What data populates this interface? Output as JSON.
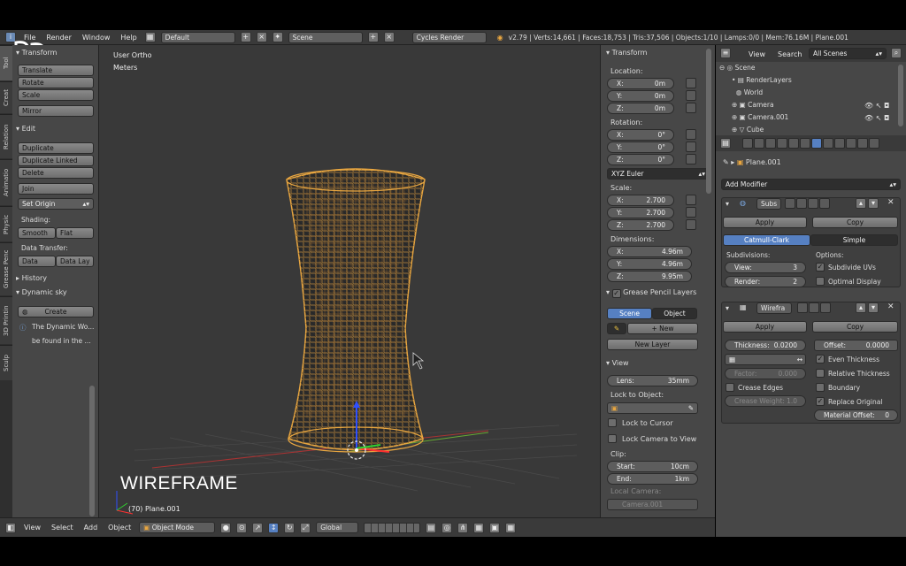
{
  "header": {
    "menus": [
      "File",
      "Render",
      "Window",
      "Help"
    ],
    "layout": "Default",
    "scene": "Scene",
    "engine": "Cycles Render",
    "stats": "v2.79 | Verts:14,661 | Faces:18,753 | Tris:37,506 | Objects:1/10 | Lamps:0/0 | Mem:76.16M | Plane.001"
  },
  "tabs": [
    "Tool",
    "Creat",
    "Relation",
    "Animatio",
    "Physic",
    "Grease Penc",
    "3D Printin",
    "Sculp"
  ],
  "toolshelf": {
    "transform_title": "Transform",
    "transform_buttons": [
      "Translate",
      "Rotate",
      "Scale"
    ],
    "mirror": "Mirror",
    "edit_title": "Edit",
    "edit_buttons": [
      "Duplicate",
      "Duplicate Linked",
      "Delete"
    ],
    "join": "Join",
    "set_origin": "Set Origin",
    "shading_label": "Shading:",
    "smooth": "Smooth",
    "flat": "Flat",
    "data_transfer_label": "Data Transfer:",
    "data": "Data",
    "data_lay": "Data Lay",
    "history": "History",
    "dynamic_sky": "Dynamic sky",
    "create": "Create",
    "info_line1": "The Dynamic Wo...",
    "info_line2": "be found in the ..."
  },
  "viewport": {
    "view_name": "User Ortho",
    "units": "Meters",
    "overlay_text": "WIREFRAME",
    "object_info": "(70) Plane.001"
  },
  "npanel": {
    "transform_title": "Transform",
    "location_label": "Location:",
    "location": [
      {
        "k": "X:",
        "v": "0m"
      },
      {
        "k": "Y:",
        "v": "0m"
      },
      {
        "k": "Z:",
        "v": "0m"
      }
    ],
    "rotation_label": "Rotation:",
    "rotation": [
      {
        "k": "X:",
        "v": "0°"
      },
      {
        "k": "Y:",
        "v": "0°"
      },
      {
        "k": "Z:",
        "v": "0°"
      }
    ],
    "rotation_mode": "XYZ Euler",
    "scale_label": "Scale:",
    "scale": [
      {
        "k": "X:",
        "v": "2.700"
      },
      {
        "k": "Y:",
        "v": "2.700"
      },
      {
        "k": "Z:",
        "v": "2.700"
      }
    ],
    "dimensions_label": "Dimensions:",
    "dimensions": [
      {
        "k": "X:",
        "v": "4.96m"
      },
      {
        "k": "Y:",
        "v": "4.96m"
      },
      {
        "k": "Z:",
        "v": "9.95m"
      }
    ],
    "grease_title": "Grease Pencil Layers",
    "gp_scene": "Scene",
    "gp_object": "Object",
    "gp_new": "New",
    "gp_new_layer": "New Layer",
    "view_title": "View",
    "lens_label": "Lens:",
    "lens_value": "35mm",
    "lock_object_label": "Lock to Object:",
    "lock_cursor": "Lock to Cursor",
    "lock_camera": "Lock Camera to View",
    "clip_label": "Clip:",
    "clip_start_label": "Start:",
    "clip_start": "10cm",
    "clip_end_label": "End:",
    "clip_end": "1km",
    "local_camera_label": "Local Camera:",
    "local_camera": "Camera.001"
  },
  "outliner": {
    "view": "View",
    "search": "Search",
    "filter": "All Scenes",
    "items": [
      "Scene",
      "RenderLayers",
      "World",
      "Camera",
      "Camera.001",
      "Cube"
    ]
  },
  "properties": {
    "object_name": "Plane.001",
    "add_modifier": "Add Modifier",
    "subsurf": {
      "name": "Subs",
      "apply": "Apply",
      "copy": "Copy",
      "type_catmull": "Catmull-Clark",
      "type_simple": "Simple",
      "subdivisions_label": "Subdivisions:",
      "options_label": "Options:",
      "view_label": "View:",
      "view_value": "3",
      "render_label": "Render:",
      "render_value": "2",
      "subdivide_uvs": "Subdivide UVs",
      "optimal_display": "Optimal Display"
    },
    "wireframe": {
      "name": "Wirefra",
      "apply": "Apply",
      "copy": "Copy",
      "thickness_label": "Thickness:",
      "thickness_value": "0.0200",
      "offset_label": "Offset:",
      "offset_value": "0.0000",
      "factor_label": "Factor:",
      "factor_value": "0.000",
      "even_thickness": "Even Thickness",
      "relative_thickness": "Relative Thickness",
      "crease_edges": "Crease Edges",
      "boundary": "Boundary",
      "crease_weight_label": "Crease Weight:",
      "crease_weight_value": "1.0",
      "replace_original": "Replace Original",
      "material_offset_label": "Material Offset:",
      "material_offset_value": "0"
    }
  },
  "bottombar": {
    "menus": [
      "View",
      "Select",
      "Add",
      "Object"
    ],
    "mode": "Object Mode",
    "orientation": "Global"
  },
  "colors": {
    "accent_blue": "#5680c2",
    "wire_orange": "#e8a640",
    "panel_bg": "#474747",
    "viewport_bg": "#393939"
  }
}
